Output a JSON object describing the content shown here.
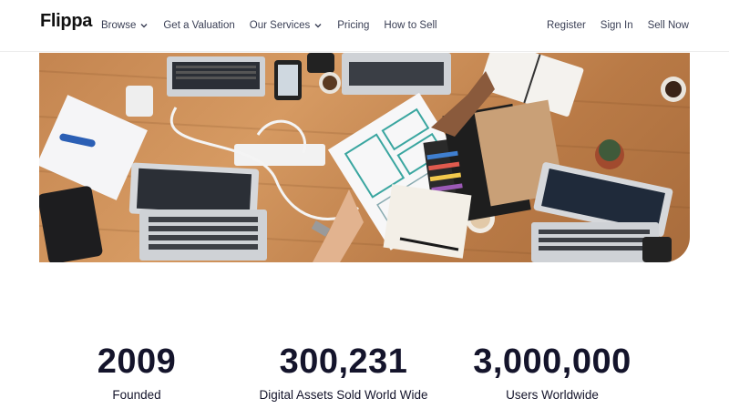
{
  "header": {
    "logo": "Flippa",
    "nav": [
      {
        "label": "Browse",
        "has_dropdown": true
      },
      {
        "label": "Get a Valuation",
        "has_dropdown": false
      },
      {
        "label": "Our Services",
        "has_dropdown": true
      },
      {
        "label": "Pricing",
        "has_dropdown": false
      },
      {
        "label": "How to Sell",
        "has_dropdown": false
      }
    ],
    "right_nav": [
      {
        "label": "Register"
      },
      {
        "label": "Sign In"
      },
      {
        "label": "Sell Now"
      }
    ]
  },
  "hero": {
    "image": "team-desk-laptops-photo"
  },
  "stats": [
    {
      "value": "2009",
      "label": "Founded"
    },
    {
      "value": "300,231",
      "label": "Digital Assets Sold World Wide"
    },
    {
      "value": "3,000,000",
      "label": "Users Worldwide"
    }
  ],
  "colors": {
    "text_dark": "#14142b",
    "nav_text": "#3a3f55",
    "desk_wood": "#c48550"
  }
}
